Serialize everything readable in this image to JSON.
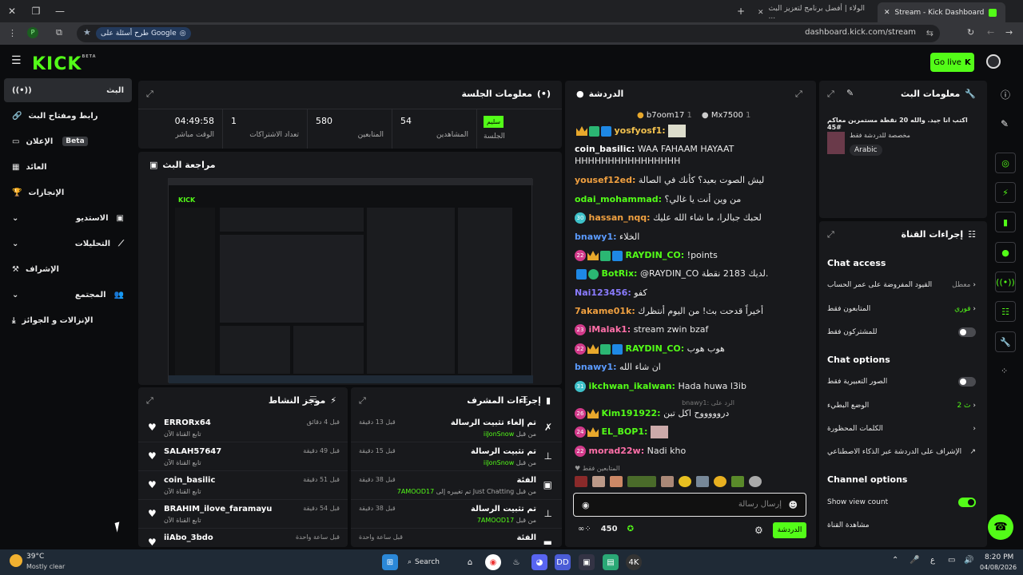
{
  "browser": {
    "tabs": [
      {
        "label": "الولاء | أفضل برنامج لتعزيز البث ..."
      },
      {
        "label": "Stream - Kick Dashboard"
      }
    ],
    "search_chip": "طرح أسئلة على Google",
    "url": "dashboard.kick.com/stream"
  },
  "header": {
    "logo": "KICK",
    "logo_sup": "BETA",
    "go_live": "Go live"
  },
  "sidebar": {
    "items": [
      {
        "label": "البث"
      },
      {
        "label": "رابط ومفتاح البث"
      },
      {
        "label": "الإعلان",
        "badge": "Beta"
      },
      {
        "label": "العائد"
      },
      {
        "label": "الإنجازات"
      },
      {
        "label": "الاستديو"
      },
      {
        "label": "التحليلات"
      },
      {
        "label": "الإشراف"
      },
      {
        "label": "المجتمع"
      },
      {
        "label": "الإنزالات و الجوائز"
      }
    ]
  },
  "session": {
    "title": "معلومات الجلسة",
    "stats": [
      {
        "label": "الوقت مباشر",
        "value": "04:49:58"
      },
      {
        "label": "تعداد الاشتراكات",
        "value": "1"
      },
      {
        "label": "المتابعين",
        "value": "580"
      },
      {
        "label": "المشاهدين",
        "value": "54"
      },
      {
        "label": "الجلسة",
        "value": "سليم"
      }
    ]
  },
  "preview": {
    "title": "مراجعة البث"
  },
  "activity": {
    "title": "موجز النشاط",
    "rows": [
      {
        "name": "ERRORx64",
        "desc": "تابع القناة الآن",
        "time": "قبل 4 دقائق"
      },
      {
        "name": "SALAH57647",
        "desc": "تابع القناة الآن",
        "time": "قبل 49 دقيقة"
      },
      {
        "name": "coin_basilic",
        "desc": "تابع القناة الآن",
        "time": "قبل 51 دقيقة"
      },
      {
        "name": "BRAHIM_ilove_faramayu",
        "desc": "تابع القناة الآن",
        "time": "قبل 54 دقيقة"
      },
      {
        "name": "iiAbo_3bdo",
        "desc": "",
        "time": "قبل ساعة واحدة"
      }
    ]
  },
  "modactions": {
    "title": "إجراءات المشرف",
    "rows": [
      {
        "name": "تم إلغاء تثبيت الرسالة",
        "desc": "من قبل",
        "user": "iiJonSnow",
        "time": "قبل 13 دقيقة"
      },
      {
        "name": "تم تثبيت الرسالة",
        "desc": "من قبل",
        "user": "iiJonSnow",
        "time": "قبل 15 دقيقة"
      },
      {
        "name": "الفئة",
        "desc": "تم تغييره إلى Just Chatting من قبل",
        "user": "7AMOOD17",
        "time": "قبل 38 دقيقة"
      },
      {
        "name": "تم تثبيت الرسالة",
        "desc": "من قبل",
        "user": "7AMOOD17",
        "time": "قبل 38 دقيقة"
      },
      {
        "name": "الفئة",
        "desc": "",
        "user": "",
        "time": "قبل ساعة واحدة"
      }
    ]
  },
  "chat": {
    "title": "الدردشة",
    "top": [
      {
        "name": "b7oom17",
        "count": "1"
      },
      {
        "name": "Mx7500",
        "count": "1"
      }
    ],
    "messages": [
      {
        "user": "yosfyosf1:",
        "text": "",
        "color": "#f2c14e"
      },
      {
        "user": "coin_basilic:",
        "text": "WAA FAHAAM HAYAAT HHHHHHHHHHHHHHHH",
        "color": "#ffffff"
      },
      {
        "user": "yousef12ed:",
        "text": "ليش الصوت بعيد؟ كأنك في الصالة",
        "color": "#f0a040"
      },
      {
        "user": "odai_mohammad:",
        "text": "من وين أنت يا غالي؟",
        "color": "#53fc18"
      },
      {
        "user": "hassan_nqq:",
        "text": "لحبك جبالرا، ما شاء الله عليك",
        "color": "#f0a040"
      },
      {
        "user": "bnawy1:",
        "text": "الخلاء",
        "color": "#5b9bff"
      },
      {
        "user": "RAYDIN_CO:",
        "text": "!points",
        "color": "#53fc18"
      },
      {
        "user": "BotRix:",
        "text": "@RAYDIN_CO لديك 2183 نقطة.",
        "color": "#53fc18"
      },
      {
        "user": "Nai123456:",
        "text": "كفو",
        "color": "#8a7bff"
      },
      {
        "user": "7akame01k:",
        "text": "أخيراً قدحت بث! من اليوم أنتظرك",
        "color": "#f0a040"
      },
      {
        "user": "iMalak1:",
        "text": "stream zwin bzaf",
        "color": "#ff6fa8"
      },
      {
        "user": "RAYDIN_CO:",
        "text": "هوب هوب",
        "color": "#53fc18"
      },
      {
        "user": "bnawy1:",
        "text": "ان شاء الله",
        "color": "#5b9bff"
      },
      {
        "user": "ikchwan_ikalwan:",
        "text": "Hada huwa l3ib",
        "color": "#53fc18"
      },
      {
        "user": "Kim191922:",
        "text": "دروووووح اكل تبن",
        "color": "#53fc18"
      },
      {
        "user": "EL_BOP1:",
        "text": "",
        "color": "#53fc18"
      },
      {
        "user": "morad22w:",
        "text": "Nadi kho",
        "color": "#ff6fa8"
      }
    ],
    "reply_note": "bnawy1: الرد على",
    "followers_only": "المتابعين فقط",
    "input_placeholder": "إرسال رسالة",
    "points": "450",
    "send": "الدردشة"
  },
  "stream_info": {
    "title": "معلومات البث",
    "stream_title": "اكتب انا جيد. والله 20 نقطة مستمرين معاكم #45",
    "category": "مخصصة للدردشة فقط",
    "tag": "Arabic"
  },
  "channel_actions": {
    "title": "إجراءات القناة",
    "chat_access": "Chat access",
    "account_age": "القيود المفروضة على عمر الحساب",
    "account_age_val": "معطل",
    "followers_only": "المتابعون فقط",
    "followers_val": "فوري",
    "subs_only": "للمشتركون فقط",
    "chat_options": "Chat options",
    "emotes_only": "الصور التعبيرية فقط",
    "slow_mode": "الوضع البطيء",
    "slow_val": "2 ث",
    "banned_words": "الكلمات المحظورة",
    "ai_mod": "الإشراف على الدردشة عبر الذكاء الاصطناعي",
    "channel_options": "Channel options",
    "show_view_count": "Show view count",
    "share": "مشاهدة القناة"
  },
  "taskbar": {
    "weather_temp": "39°C",
    "weather_desc": "Mostly clear",
    "search": "Search",
    "time": "8:20 PM",
    "date": "04/08/2026",
    "lang": "ع"
  }
}
